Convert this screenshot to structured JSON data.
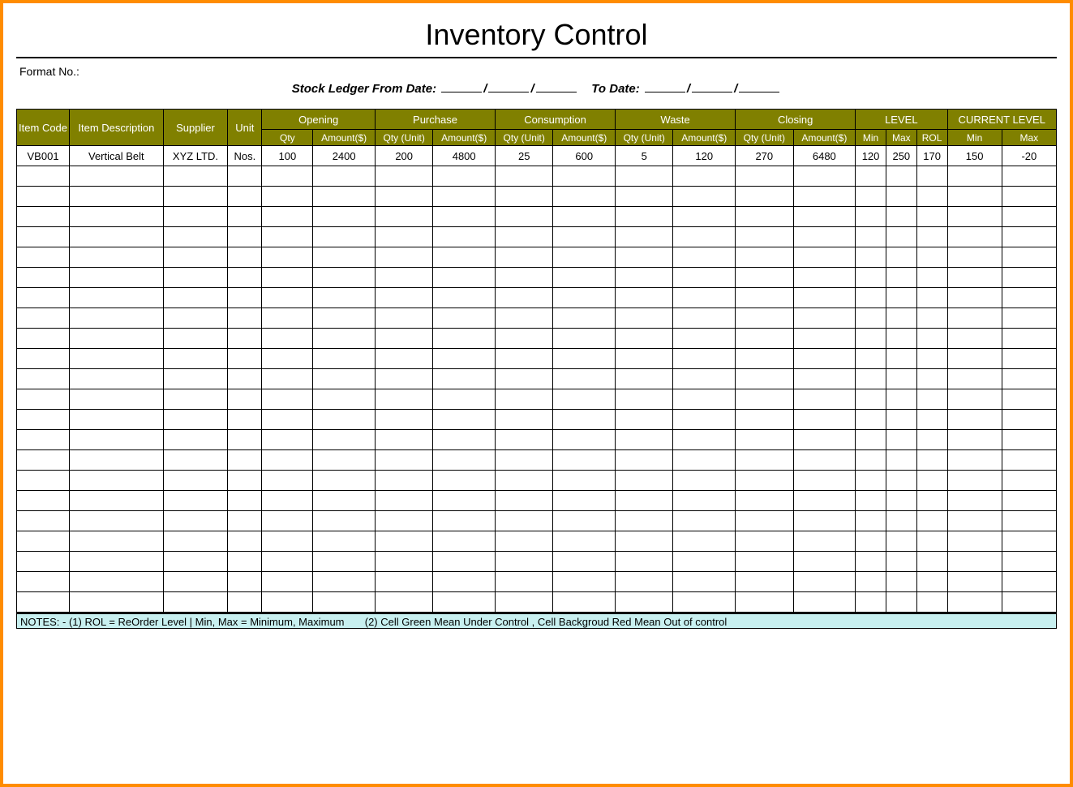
{
  "title": "Inventory Control",
  "format_label": "Format No.:",
  "ledger": {
    "prefix": "Stock Ledger From Date:",
    "to_label": "To Date:",
    "slash": "/"
  },
  "headers": {
    "item_code": "Item Code",
    "item_desc": "Item Description",
    "supplier": "Supplier",
    "unit": "Unit",
    "opening": "Opening",
    "purchase": "Purchase",
    "consumption": "Consumption",
    "waste": "Waste",
    "closing": "Closing",
    "level": "LEVEL",
    "current_level": "CURRENT LEVEL",
    "qty": "Qty",
    "amount": "Amount($)",
    "qty_unit": "Qty (Unit)",
    "min": "Min",
    "max": "Max",
    "rol": "ROL"
  },
  "row": {
    "item_code": "VB001",
    "item_desc": "Vertical Belt",
    "supplier": "XYZ LTD.",
    "unit": "Nos.",
    "opening_qty": "100",
    "opening_amt": "2400",
    "purchase_qty": "200",
    "purchase_amt": "4800",
    "consumption_qty": "25",
    "consumption_amt": "600",
    "waste_qty": "5",
    "waste_amt": "120",
    "closing_qty": "270",
    "closing_amt": "6480",
    "level_min": "120",
    "level_max": "250",
    "level_rol": "170",
    "current_min": "150",
    "current_max": "-20"
  },
  "empty_rows": 22,
  "notes": {
    "prefix": "NOTES: -",
    "n1": "(1) ROL = ReOrder Level | Min, Max = Minimum, Maximum",
    "n2": "(2) Cell Green Mean Under Control , Cell Backgroud Red Mean Out of control"
  }
}
